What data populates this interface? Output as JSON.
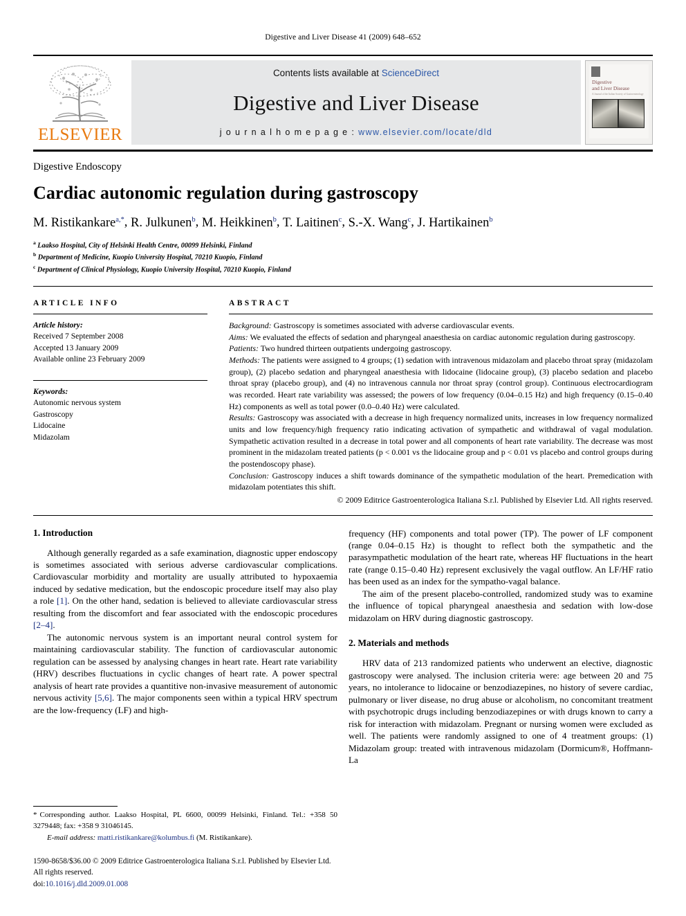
{
  "running_head": "Digestive and Liver Disease 41 (2009) 648–652",
  "masthead": {
    "publisher_name": "ELSEVIER",
    "contents_prefix": "Contents lists available at ",
    "contents_link": "ScienceDirect",
    "journal_title": "Digestive and Liver Disease",
    "homepage_prefix": "j o u r n a l   h o m e p a g e :  ",
    "homepage_url": "www.elsevier.com/locate/dld",
    "cover": {
      "line1": "Digestive",
      "line2": "and Liver Disease",
      "line3": "A Journal of the Italian Society of Gastroenterology"
    }
  },
  "article": {
    "section_kind": "Digestive Endoscopy",
    "title": "Cardiac autonomic regulation during gastroscopy",
    "authors": "M. Ristikankare a,*, R. Julkunen b, M. Heikkinen b, T. Laitinen c, S.-X. Wang c, J. Hartikainen b",
    "author_list": [
      {
        "name": "M. Ristikankare",
        "sup": "a,*"
      },
      {
        "name": "R. Julkunen",
        "sup": "b"
      },
      {
        "name": "M. Heikkinen",
        "sup": "b"
      },
      {
        "name": "T. Laitinen",
        "sup": "c"
      },
      {
        "name": "S.-X. Wang",
        "sup": "c"
      },
      {
        "name": "J. Hartikainen",
        "sup": "b"
      }
    ],
    "affiliations": [
      {
        "sup": "a",
        "text": "Laakso Hospital, City of Helsinki Health Centre, 00099 Helsinki, Finland"
      },
      {
        "sup": "b",
        "text": "Department of Medicine, Kuopio University Hospital, 70210 Kuopio, Finland"
      },
      {
        "sup": "c",
        "text": "Department of Clinical Physiology, Kuopio University Hospital, 70210 Kuopio, Finland"
      }
    ]
  },
  "article_info": {
    "heading": "ARTICLE INFO",
    "history_label": "Article history:",
    "history": [
      "Received 7 September 2008",
      "Accepted 13 January 2009",
      "Available online 23 February 2009"
    ],
    "keywords_label": "Keywords:",
    "keywords": [
      "Autonomic nervous system",
      "Gastroscopy",
      "Lidocaine",
      "Midazolam"
    ]
  },
  "abstract": {
    "heading": "ABSTRACT",
    "background_label": "Background:",
    "background_text": " Gastroscopy is sometimes associated with adverse cardiovascular events.",
    "aims_label": "Aims:",
    "aims_text": " We evaluated the effects of sedation and pharyngeal anaesthesia on cardiac autonomic regulation during gastroscopy.",
    "patients_label": "Patients:",
    "patients_text": " Two hundred thirteen outpatients undergoing gastroscopy.",
    "methods_label": "Methods:",
    "methods_text": " The patients were assigned to 4 groups; (1) sedation with intravenous midazolam and placebo throat spray (midazolam group), (2) placebo sedation and pharyngeal anaesthesia with lidocaine (lidocaine group), (3) placebo sedation and placebo throat spray (placebo group), and (4) no intravenous cannula nor throat spray (control group). Continuous electrocardiogram was recorded. Heart rate variability was assessed; the powers of low frequency (0.04–0.15 Hz) and high frequency (0.15–0.40 Hz) components as well as total power (0.0–0.40 Hz) were calculated.",
    "results_label": "Results:",
    "results_text": " Gastroscopy was associated with a decrease in high frequency normalized units, increases in low frequency normalized units and low frequency/high frequency ratio indicating activation of sympathetic and withdrawal of vagal modulation. Sympathetic activation resulted in a decrease in total power and all components of heart rate variability. The decrease was most prominent in the midazolam treated patients (p < 0.001 vs the lidocaine group and p < 0.01 vs placebo and control groups during the postendoscopy phase).",
    "conclusion_label": "Conclusion:",
    "conclusion_text": " Gastroscopy induces a shift towards dominance of the sympathetic modulation of the heart. Premedication with midazolam potentiates this shift.",
    "copyright": "© 2009 Editrice Gastroenterologica Italiana S.r.l. Published by Elsevier Ltd. All rights reserved."
  },
  "body": {
    "left": {
      "intro_heading": "1.  Introduction",
      "p1_a": "Although generally regarded as a safe examination, diagnostic upper endoscopy is sometimes associated with serious adverse cardiovascular complications. Cardiovascular morbidity and mortality are usually attributed to hypoxaemia induced by sedative medication, but the endoscopic procedure itself may also play a role ",
      "p1_ref1": "[1]",
      "p1_b": ". On the other hand, sedation is believed to alleviate cardiovascular stress resulting from the discomfort and fear associated with the endoscopic procedures ",
      "p1_ref2": "[2–4]",
      "p1_c": ".",
      "p2_a": "The autonomic nervous system is an important neural control system for maintaining cardiovascular stability. The function of cardiovascular autonomic regulation can be assessed by analysing changes in heart rate. Heart rate variability (HRV) describes fluctuations in cyclic changes of heart rate. A power spectral analysis of heart rate provides a quantitive non-invasive measurement of autonomic nervous activity ",
      "p2_ref": "[5,6]",
      "p2_b": ". The major components seen within a typical HRV spectrum are the low-frequency (LF) and high-"
    },
    "right": {
      "p3": "frequency (HF) components and total power (TP). The power of LF component (range 0.04–0.15 Hz) is thought to reflect both the sympathetic and the parasympathetic modulation of the heart rate, whereas HF fluctuations in the heart rate (range 0.15–0.40 Hz) represent exclusively the vagal outflow. An LF/HF ratio has been used as an index for the sympatho-vagal balance.",
      "p4": "The aim of the present placebo-controlled, randomized study was to examine the influence of topical pharyngeal anaesthesia and sedation with low-dose midazolam on HRV during diagnostic gastroscopy.",
      "methods_heading": "2.  Materials and methods",
      "p5": "HRV data of 213 randomized patients who underwent an elective, diagnostic gastroscopy were analysed. The inclusion criteria were: age between 20 and 75 years, no intolerance to lidocaine or benzodiazepines, no history of severe cardiac, pulmonary or liver disease, no drug abuse or alcoholism, no concomitant treatment with psychotropic drugs including benzodiazepines or with drugs known to carry a risk for interaction with midazolam. Pregnant or nursing women were excluded as well. The patients were randomly assigned to one of 4 treatment groups: (1) Midazolam group: treated with intravenous midazolam (Dormicum®, Hoffmann-La"
    }
  },
  "footnotes": {
    "corresponding_star": "*",
    "corresponding_text": "Corresponding author. Laakso Hospital, PL 6600, 00099 Helsinki, Finland. Tel.: +358 50 3279448; fax: +358 9 31046145.",
    "email_label": "E-mail address:",
    "email_address": "matti.ristikankare@kolumbus.fi",
    "email_suffix": " (M. Ristikankare).",
    "issn_line": "1590-8658/$36.00 © 2009 Editrice Gastroenterologica Italiana S.r.l. Published by Elsevier Ltd. All rights reserved.",
    "doi_prefix": "doi:",
    "doi_value": "10.1016/j.dld.2009.01.008"
  },
  "colors": {
    "link": "#1a2f80",
    "elsevier_orange": "#E87A10",
    "masthead_grey": "#e6e7e8"
  }
}
